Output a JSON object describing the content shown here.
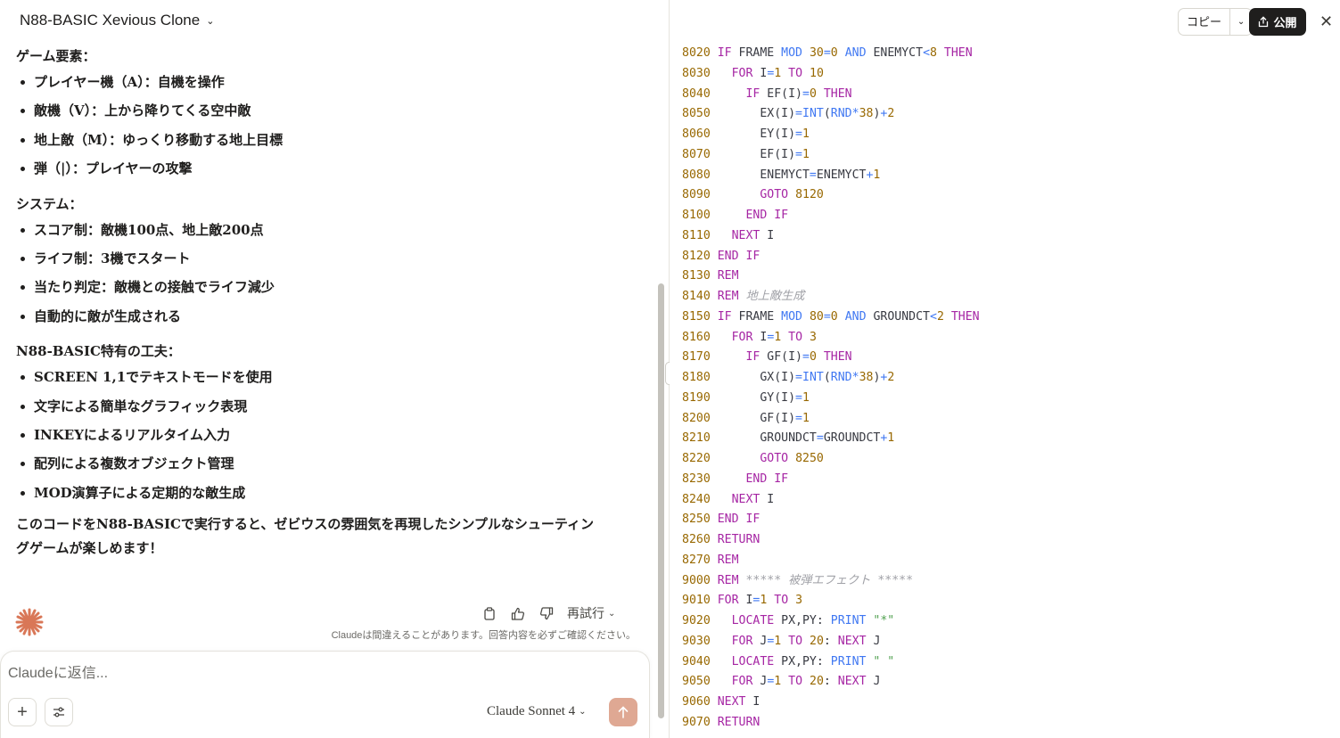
{
  "header": {
    "title": "N88-BASIC Xevious Clone"
  },
  "message": {
    "sections": [
      {
        "heading": "ゲーム要素：",
        "items": [
          "プレイヤー機（A）：自機を操作",
          "敵機（V）：上から降りてくる空中敵",
          "地上敵（M）：ゆっくり移動する地上目標",
          "弾（|）：プレイヤーの攻撃"
        ]
      },
      {
        "heading": "システム：",
        "items": [
          "スコア制：敵機100点、地上敵200点",
          "ライフ制：3機でスタート",
          "当たり判定：敵機との接触でライフ減少",
          "自動的に敵が生成される"
        ]
      },
      {
        "heading": "N88-BASIC特有の工夫：",
        "items": [
          "SCREEN 1,1でテキストモードを使用",
          "文字による簡単なグラフィック表現",
          "INKEYによるリアルタイム入力",
          "配列による複数オブジェクト管理",
          "MOD演算子による定期的な敵生成"
        ]
      }
    ],
    "conclusion_line1": "このコードをN88-BASICで実行すると、ゼビウスの雰囲気を再現したシンプルなシューティン",
    "conclusion_line2": "グゲームが楽しめます！"
  },
  "actions": {
    "retry_label": "再試行",
    "disclaimer": "Claudeは間違えることがあります。回答内容を必ずご確認ください。"
  },
  "composer": {
    "placeholder": "Claudeに返信...",
    "model_label": "Claude Sonnet 4"
  },
  "artifact": {
    "copy_label": "コピー",
    "publish_label": "公開"
  },
  "code_lines": [
    [
      [
        "ln",
        "8020 "
      ],
      [
        "kw",
        "IF"
      ],
      [
        "id",
        " FRAME "
      ],
      [
        "fn",
        "MOD"
      ],
      [
        "id",
        " "
      ],
      [
        "num",
        "30"
      ],
      [
        "fn",
        "="
      ],
      [
        "num",
        "0"
      ],
      [
        "id",
        " "
      ],
      [
        "fn",
        "AND"
      ],
      [
        "id",
        " ENEMYCT"
      ],
      [
        "fn",
        "<"
      ],
      [
        "num",
        "8"
      ],
      [
        "id",
        " "
      ],
      [
        "kw",
        "THEN"
      ]
    ],
    [
      [
        "ln",
        "8030 "
      ],
      [
        "id",
        "  "
      ],
      [
        "kw",
        "FOR"
      ],
      [
        "id",
        " I"
      ],
      [
        "fn",
        "="
      ],
      [
        "num",
        "1"
      ],
      [
        "id",
        " "
      ],
      [
        "kw",
        "TO"
      ],
      [
        "id",
        " "
      ],
      [
        "num",
        "10"
      ]
    ],
    [
      [
        "ln",
        "8040 "
      ],
      [
        "id",
        "    "
      ],
      [
        "kw",
        "IF"
      ],
      [
        "id",
        " EF(I)"
      ],
      [
        "fn",
        "="
      ],
      [
        "num",
        "0"
      ],
      [
        "id",
        " "
      ],
      [
        "kw",
        "THEN"
      ]
    ],
    [
      [
        "ln",
        "8050 "
      ],
      [
        "id",
        "      EX(I)"
      ],
      [
        "fn",
        "="
      ],
      [
        "fn",
        "INT"
      ],
      [
        "id",
        "("
      ],
      [
        "fn",
        "RND"
      ],
      [
        "fn",
        "*"
      ],
      [
        "num",
        "38"
      ],
      [
        "id",
        ")"
      ],
      [
        "fn",
        "+"
      ],
      [
        "num",
        "2"
      ]
    ],
    [
      [
        "ln",
        "8060 "
      ],
      [
        "id",
        "      EY(I)"
      ],
      [
        "fn",
        "="
      ],
      [
        "num",
        "1"
      ]
    ],
    [
      [
        "ln",
        "8070 "
      ],
      [
        "id",
        "      EF(I)"
      ],
      [
        "fn",
        "="
      ],
      [
        "num",
        "1"
      ]
    ],
    [
      [
        "ln",
        "8080 "
      ],
      [
        "id",
        "      ENEMYCT"
      ],
      [
        "fn",
        "="
      ],
      [
        "id",
        "ENEMYCT"
      ],
      [
        "fn",
        "+"
      ],
      [
        "num",
        "1"
      ]
    ],
    [
      [
        "ln",
        "8090 "
      ],
      [
        "id",
        "      "
      ],
      [
        "kw",
        "GOTO"
      ],
      [
        "id",
        " "
      ],
      [
        "num",
        "8120"
      ]
    ],
    [
      [
        "ln",
        "8100 "
      ],
      [
        "id",
        "    "
      ],
      [
        "kw",
        "END IF"
      ]
    ],
    [
      [
        "ln",
        "8110 "
      ],
      [
        "id",
        "  "
      ],
      [
        "kw",
        "NEXT"
      ],
      [
        "id",
        " I"
      ]
    ],
    [
      [
        "ln",
        "8120 "
      ],
      [
        "kw",
        "END IF"
      ]
    ],
    [
      [
        "ln",
        "8130 "
      ],
      [
        "kw",
        "REM"
      ]
    ],
    [
      [
        "ln",
        "8140 "
      ],
      [
        "kw",
        "REM"
      ],
      [
        "cmt",
        " 地上敵生成"
      ]
    ],
    [
      [
        "ln",
        "8150 "
      ],
      [
        "kw",
        "IF"
      ],
      [
        "id",
        " FRAME "
      ],
      [
        "fn",
        "MOD"
      ],
      [
        "id",
        " "
      ],
      [
        "num",
        "80"
      ],
      [
        "fn",
        "="
      ],
      [
        "num",
        "0"
      ],
      [
        "id",
        " "
      ],
      [
        "fn",
        "AND"
      ],
      [
        "id",
        " GROUNDCT"
      ],
      [
        "fn",
        "<"
      ],
      [
        "num",
        "2"
      ],
      [
        "id",
        " "
      ],
      [
        "kw",
        "THEN"
      ]
    ],
    [
      [
        "ln",
        "8160 "
      ],
      [
        "id",
        "  "
      ],
      [
        "kw",
        "FOR"
      ],
      [
        "id",
        " I"
      ],
      [
        "fn",
        "="
      ],
      [
        "num",
        "1"
      ],
      [
        "id",
        " "
      ],
      [
        "kw",
        "TO"
      ],
      [
        "id",
        " "
      ],
      [
        "num",
        "3"
      ]
    ],
    [
      [
        "ln",
        "8170 "
      ],
      [
        "id",
        "    "
      ],
      [
        "kw",
        "IF"
      ],
      [
        "id",
        " GF(I)"
      ],
      [
        "fn",
        "="
      ],
      [
        "num",
        "0"
      ],
      [
        "id",
        " "
      ],
      [
        "kw",
        "THEN"
      ]
    ],
    [
      [
        "ln",
        "8180 "
      ],
      [
        "id",
        "      GX(I)"
      ],
      [
        "fn",
        "="
      ],
      [
        "fn",
        "INT"
      ],
      [
        "id",
        "("
      ],
      [
        "fn",
        "RND"
      ],
      [
        "fn",
        "*"
      ],
      [
        "num",
        "38"
      ],
      [
        "id",
        ")"
      ],
      [
        "fn",
        "+"
      ],
      [
        "num",
        "2"
      ]
    ],
    [
      [
        "ln",
        "8190 "
      ],
      [
        "id",
        "      GY(I)"
      ],
      [
        "fn",
        "="
      ],
      [
        "num",
        "1"
      ]
    ],
    [
      [
        "ln",
        "8200 "
      ],
      [
        "id",
        "      GF(I)"
      ],
      [
        "fn",
        "="
      ],
      [
        "num",
        "1"
      ]
    ],
    [
      [
        "ln",
        "8210 "
      ],
      [
        "id",
        "      GROUNDCT"
      ],
      [
        "fn",
        "="
      ],
      [
        "id",
        "GROUNDCT"
      ],
      [
        "fn",
        "+"
      ],
      [
        "num",
        "1"
      ]
    ],
    [
      [
        "ln",
        "8220 "
      ],
      [
        "id",
        "      "
      ],
      [
        "kw",
        "GOTO"
      ],
      [
        "id",
        " "
      ],
      [
        "num",
        "8250"
      ]
    ],
    [
      [
        "ln",
        "8230 "
      ],
      [
        "id",
        "    "
      ],
      [
        "kw",
        "END IF"
      ]
    ],
    [
      [
        "ln",
        "8240 "
      ],
      [
        "id",
        "  "
      ],
      [
        "kw",
        "NEXT"
      ],
      [
        "id",
        " I"
      ]
    ],
    [
      [
        "ln",
        "8250 "
      ],
      [
        "kw",
        "END IF"
      ]
    ],
    [
      [
        "ln",
        "8260 "
      ],
      [
        "kw",
        "RETURN"
      ]
    ],
    [
      [
        "ln",
        "8270 "
      ],
      [
        "kw",
        "REM"
      ]
    ],
    [
      [
        "ln",
        "9000 "
      ],
      [
        "kw",
        "REM"
      ],
      [
        "cmt",
        " ***** 被弾エフェクト *****"
      ]
    ],
    [
      [
        "ln",
        "9010 "
      ],
      [
        "kw",
        "FOR"
      ],
      [
        "id",
        " I"
      ],
      [
        "fn",
        "="
      ],
      [
        "num",
        "1"
      ],
      [
        "id",
        " "
      ],
      [
        "kw",
        "TO"
      ],
      [
        "id",
        " "
      ],
      [
        "num",
        "3"
      ]
    ],
    [
      [
        "ln",
        "9020 "
      ],
      [
        "id",
        "  "
      ],
      [
        "kw",
        "LOCATE"
      ],
      [
        "id",
        " PX,PY: "
      ],
      [
        "fn",
        "PRINT"
      ],
      [
        "id",
        " "
      ],
      [
        "str",
        "\"*\""
      ]
    ],
    [
      [
        "ln",
        "9030 "
      ],
      [
        "id",
        "  "
      ],
      [
        "kw",
        "FOR"
      ],
      [
        "id",
        " J"
      ],
      [
        "fn",
        "="
      ],
      [
        "num",
        "1"
      ],
      [
        "id",
        " "
      ],
      [
        "kw",
        "TO"
      ],
      [
        "id",
        " "
      ],
      [
        "num",
        "20"
      ],
      [
        "id",
        ": "
      ],
      [
        "kw",
        "NEXT"
      ],
      [
        "id",
        " J"
      ]
    ],
    [
      [
        "ln",
        "9040 "
      ],
      [
        "id",
        "  "
      ],
      [
        "kw",
        "LOCATE"
      ],
      [
        "id",
        " PX,PY: "
      ],
      [
        "fn",
        "PRINT"
      ],
      [
        "id",
        " "
      ],
      [
        "str",
        "\" \""
      ]
    ],
    [
      [
        "ln",
        "9050 "
      ],
      [
        "id",
        "  "
      ],
      [
        "kw",
        "FOR"
      ],
      [
        "id",
        " J"
      ],
      [
        "fn",
        "="
      ],
      [
        "num",
        "1"
      ],
      [
        "id",
        " "
      ],
      [
        "kw",
        "TO"
      ],
      [
        "id",
        " "
      ],
      [
        "num",
        "20"
      ],
      [
        "id",
        ": "
      ],
      [
        "kw",
        "NEXT"
      ],
      [
        "id",
        " J"
      ]
    ],
    [
      [
        "ln",
        "9060 "
      ],
      [
        "kw",
        "NEXT"
      ],
      [
        "id",
        " I"
      ]
    ],
    [
      [
        "ln",
        "9070 "
      ],
      [
        "kw",
        "RETURN"
      ]
    ]
  ]
}
